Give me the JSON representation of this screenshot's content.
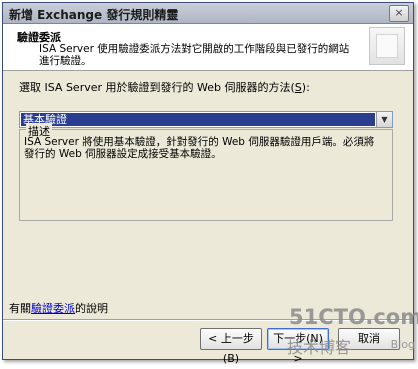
{
  "window": {
    "title": "新增 Exchange 發行規則精靈",
    "close_label": "×"
  },
  "header": {
    "title": "驗證委派",
    "description": "ISA Server 使用驗證委派方法對它開啟的工作階段與已發行的網站進行驗證。"
  },
  "form": {
    "choose_label_before": "選取 ISA Server 用於驗證到發行的 Web 伺服器的方法(",
    "choose_label_hotkey": "S",
    "choose_label_after": "):",
    "selected_method": "基本驗證",
    "group_title": "描述",
    "description": "ISA Server 將使用基本驗證，針對發行的 Web 伺服器驗證用戶端。必須將發行的 Web 伺服器設定成接受基本驗證。"
  },
  "help": {
    "prefix": "有關",
    "link": "驗證委派",
    "suffix": "的說明"
  },
  "buttons": {
    "back": "< 上一步(B)",
    "next": "下一步(N) >",
    "cancel": "取消"
  },
  "watermark": {
    "line1": "51CTO.com",
    "line2": "技术博客",
    "line3": "Blog"
  }
}
